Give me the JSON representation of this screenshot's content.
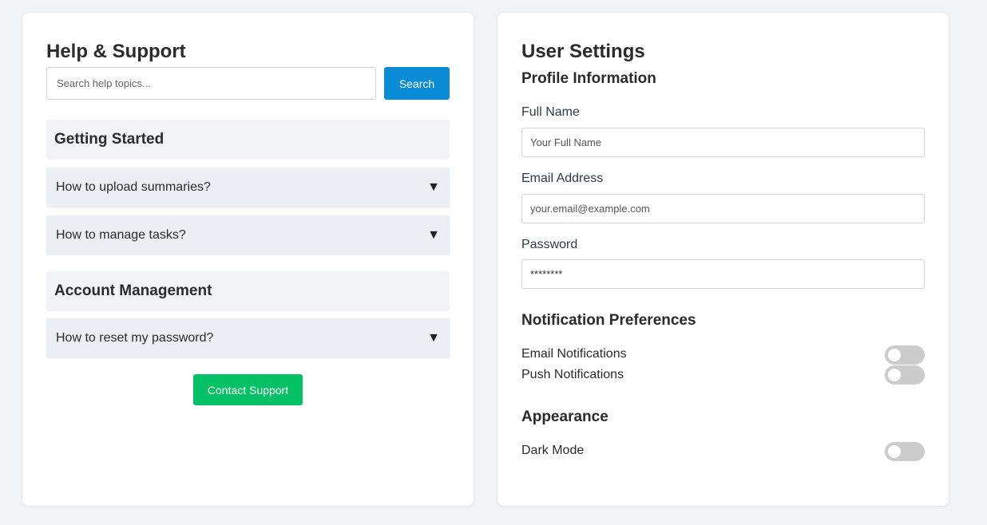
{
  "help": {
    "title": "Help & Support",
    "search_placeholder": "Search help topics...",
    "search_label": "Search",
    "sections": [
      {
        "title": "Getting Started",
        "items": [
          {
            "question": "How to upload summaries?",
            "caret": "▼"
          },
          {
            "question": "How to manage tasks?",
            "caret": "▼"
          }
        ]
      },
      {
        "title": "Account Management",
        "items": [
          {
            "question": "How to reset my password?",
            "caret": "▼"
          }
        ]
      }
    ],
    "contact_label": "Contact Support"
  },
  "settings": {
    "title": "User Settings",
    "profile": {
      "heading": "Profile Information",
      "full_name_label": "Full Name",
      "full_name_placeholder": "Your Full Name",
      "email_label": "Email Address",
      "email_placeholder": "your.email@example.com",
      "password_label": "Password",
      "password_value": "********"
    },
    "notifications": {
      "heading": "Notification Preferences",
      "email_label": "Email Notifications",
      "email_enabled": false,
      "push_label": "Push Notifications",
      "push_enabled": false
    },
    "appearance": {
      "heading": "Appearance",
      "dark_mode_label": "Dark Mode",
      "dark_mode_enabled": false
    }
  },
  "colors": {
    "search_button": "#0a8bd6",
    "contact_button": "#05c166",
    "toggle_off": "#cccccc"
  }
}
